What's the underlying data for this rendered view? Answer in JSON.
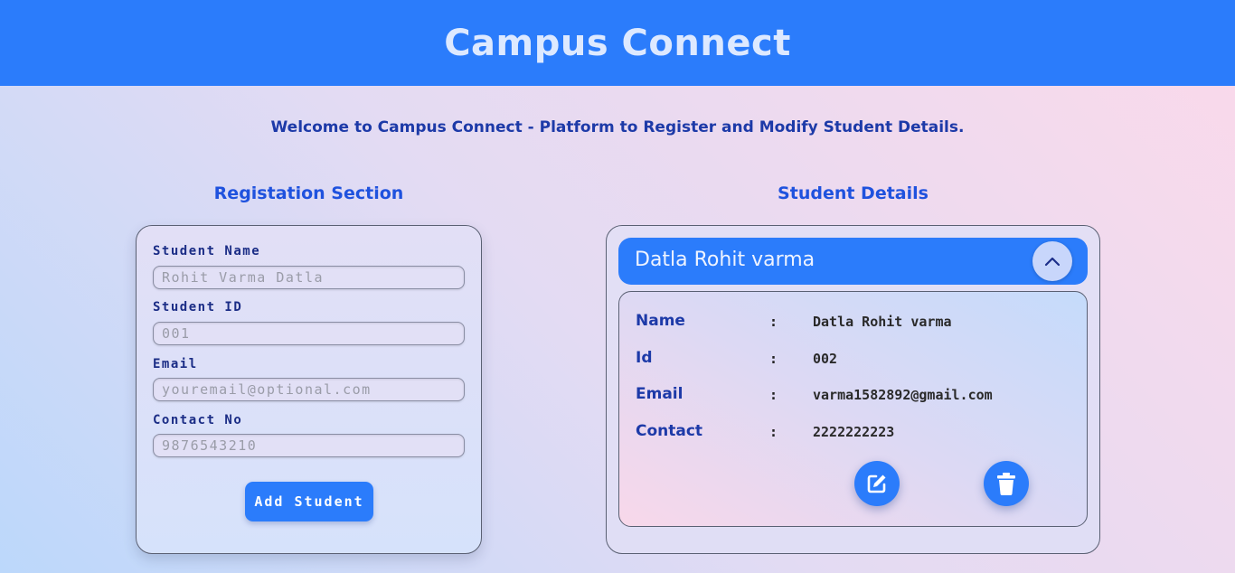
{
  "header": {
    "title": "Campus Connect"
  },
  "welcome": "Welcome to Campus Connect - Platform to Register and Modify Student Details.",
  "registration": {
    "title": "Registation Section",
    "fields": [
      {
        "label": "Student Name",
        "placeholder": "Rohit Varma Datla",
        "value": ""
      },
      {
        "label": "Student ID",
        "placeholder": "001",
        "value": ""
      },
      {
        "label": "Email",
        "placeholder": "youremail@optional.com",
        "value": ""
      },
      {
        "label": "Contact No",
        "placeholder": "9876543210",
        "value": ""
      }
    ],
    "submit_label": "Add Student"
  },
  "details": {
    "title": "Student Details",
    "student": {
      "header_name": "Datla Rohit varma",
      "rows": [
        {
          "label": "Name",
          "sep": ":",
          "value": "Datla Rohit varma"
        },
        {
          "label": "Id",
          "sep": ":",
          "value": "002"
        },
        {
          "label": "Email",
          "sep": ":",
          "value": "varma1582892@gmail.com"
        },
        {
          "label": "Contact",
          "sep": ":",
          "value": "2222222223"
        }
      ],
      "expanded": true
    },
    "icons": {
      "toggle": "chevron-up-icon",
      "edit": "edit-icon",
      "delete": "trash-icon"
    }
  },
  "colors": {
    "primary": "#2b7cfb",
    "heading": "#1f52de",
    "text_dark": "#1d3aa8"
  }
}
